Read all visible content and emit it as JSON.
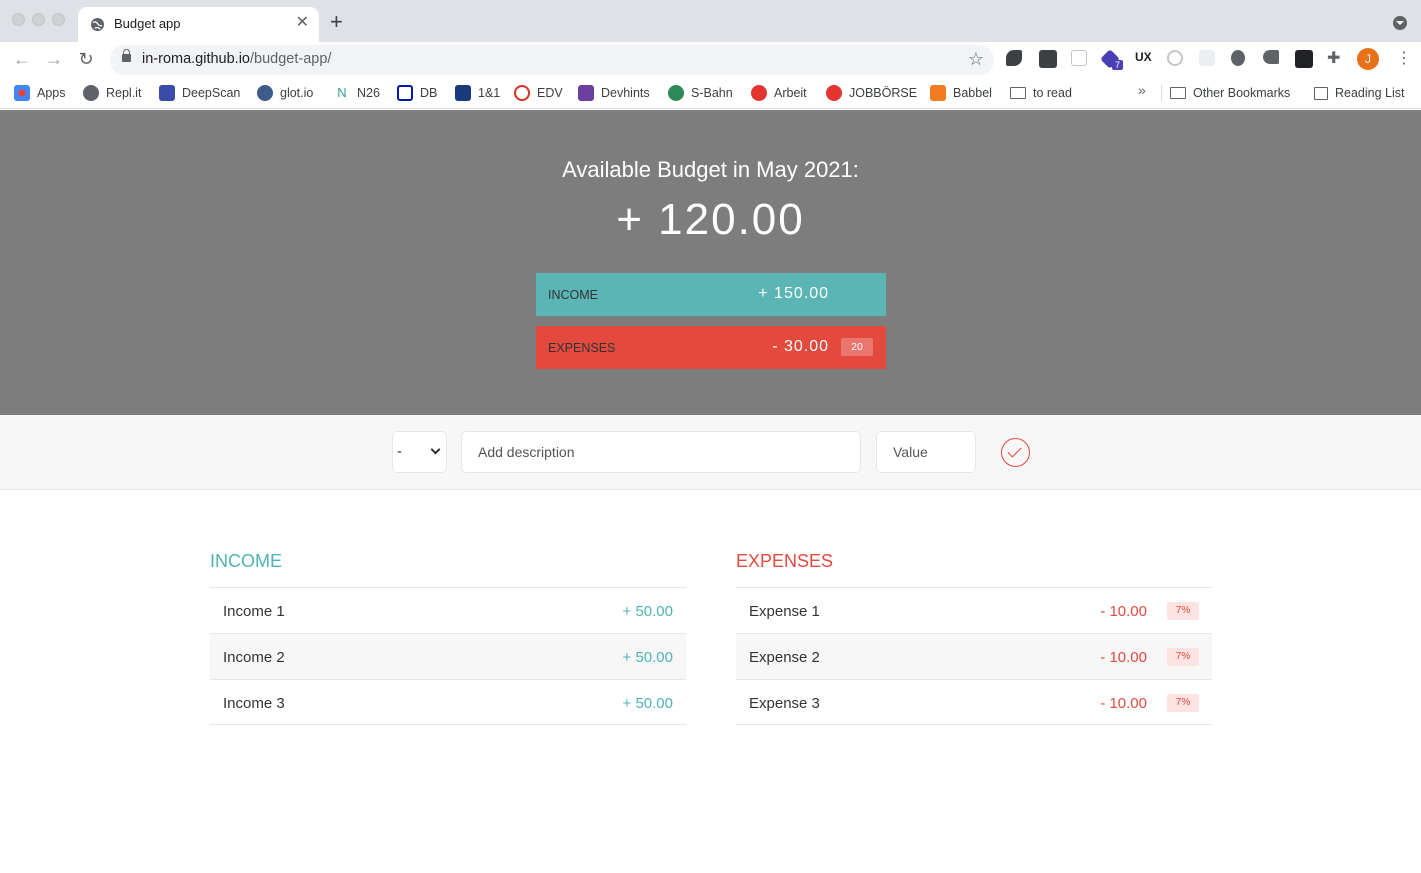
{
  "browser": {
    "tab_title": "Budget app",
    "url_host": "in-roma.github.io",
    "url_path": "/budget-app/",
    "profile_initial": "J",
    "extension_badge": "7",
    "bookmarks": [
      "Apps",
      "Repl.it",
      "DeepScan",
      "glot.io",
      "N26",
      "DB",
      "1&1",
      "EDV",
      "Devhints",
      "S-Bahn",
      "Arbeit",
      "JOBBÖRSE",
      "Babbel",
      "to read"
    ],
    "other_bookmarks": "Other Bookmarks",
    "reading_list": "Reading List"
  },
  "budget": {
    "title": "Available Budget in May 2021:",
    "value": "+ 120.00",
    "income_label": "Income",
    "income_value": "+ 150.00",
    "expenses_label": "Expenses",
    "expenses_value": "- 30.00",
    "expenses_percent": "20"
  },
  "add": {
    "type_value": "-",
    "description_placeholder": "Add description",
    "value_placeholder": "Value"
  },
  "income": {
    "title": "Income",
    "items": [
      {
        "description": "Income 1",
        "value": "+ 50.00"
      },
      {
        "description": "Income 2",
        "value": "+ 50.00"
      },
      {
        "description": "Income 3",
        "value": "+ 50.00"
      }
    ]
  },
  "expenses": {
    "title": "Expenses",
    "items": [
      {
        "description": "Expense 1",
        "value": "- 10.00",
        "percent": "7%"
      },
      {
        "description": "Expense 2",
        "value": "- 10.00",
        "percent": "7%"
      },
      {
        "description": "Expense 3",
        "value": "- 10.00",
        "percent": "7%"
      }
    ]
  },
  "colors": {
    "income": "#5bb5b5",
    "expenses": "#e3493d",
    "header_bg": "#7d7d7d"
  }
}
